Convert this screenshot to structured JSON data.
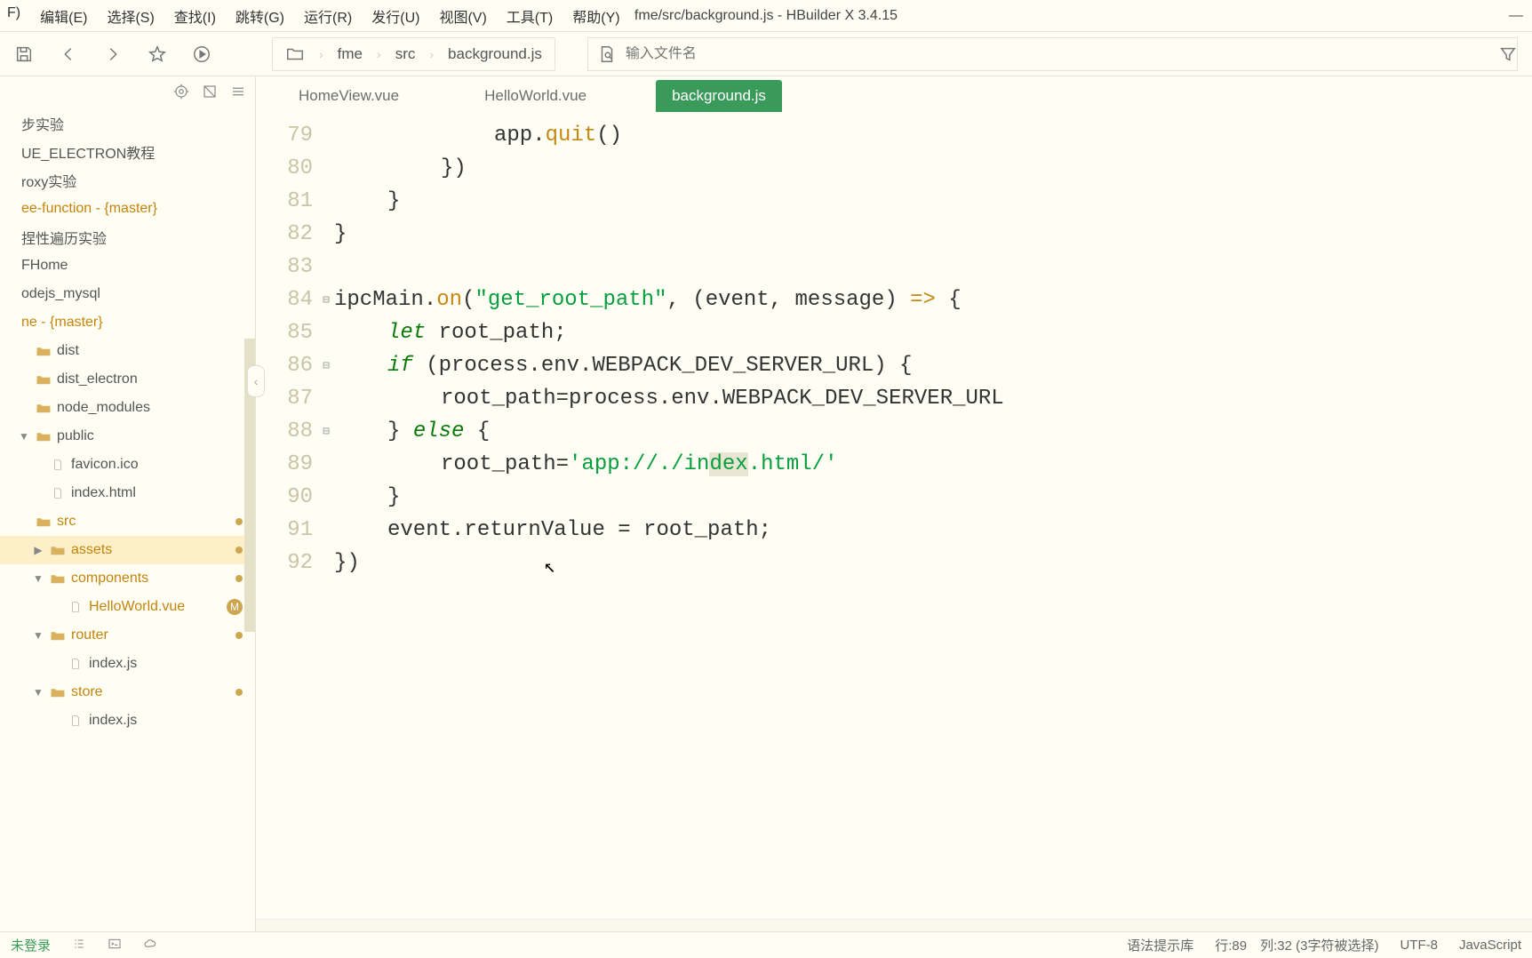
{
  "menus": [
    "F)",
    "编辑(E)",
    "选择(S)",
    "查找(I)",
    "跳转(G)",
    "运行(R)",
    "发行(U)",
    "视图(V)",
    "工具(T)",
    "帮助(Y)"
  ],
  "window_title": "fme/src/background.js - HBuilder X 3.4.15",
  "breadcrumb": [
    "fme",
    "src",
    "background.js"
  ],
  "search_placeholder": "输入文件名",
  "tabs": [
    {
      "label": "HomeView.vue",
      "active": false
    },
    {
      "label": "HelloWorld.vue",
      "active": false
    },
    {
      "label": "background.js",
      "active": true
    }
  ],
  "code": {
    "lines": [
      {
        "n": "79",
        "indent": "i4",
        "tokens": [
          {
            "t": "app."
          },
          {
            "t": "quit",
            "c": "fn"
          },
          {
            "t": "()"
          }
        ]
      },
      {
        "n": "80",
        "indent": "i3",
        "tokens": [
          {
            "t": "})"
          }
        ]
      },
      {
        "n": "81",
        "indent": "i2",
        "tokens": [
          {
            "t": "}"
          }
        ]
      },
      {
        "n": "82",
        "indent": "i1",
        "tokens": [
          {
            "t": "}"
          }
        ]
      },
      {
        "n": "83",
        "indent": "i1",
        "tokens": []
      },
      {
        "n": "84",
        "indent": "i1",
        "fold": "⊟",
        "tokens": [
          {
            "t": "ipcMain."
          },
          {
            "t": "on",
            "c": "fn"
          },
          {
            "t": "("
          },
          {
            "t": "\"get_root_path\"",
            "c": "str"
          },
          {
            "t": ", (event, message) "
          },
          {
            "t": "=>",
            "c": "fn"
          },
          {
            "t": " {"
          }
        ]
      },
      {
        "n": "85",
        "indent": "i2",
        "tokens": [
          {
            "t": "let",
            "c": "kw"
          },
          {
            "t": " root_path;"
          }
        ]
      },
      {
        "n": "86",
        "indent": "i2",
        "fold": "⊟",
        "tokens": [
          {
            "t": "if",
            "c": "kw"
          },
          {
            "t": " (process.env.WEBPACK_DEV_SERVER_URL) {"
          }
        ]
      },
      {
        "n": "87",
        "indent": "i3",
        "tokens": [
          {
            "t": "root_path=process.env.WEBPACK_DEV_SERVER_URL"
          }
        ]
      },
      {
        "n": "88",
        "indent": "i2",
        "fold": "⊟",
        "tokens": [
          {
            "t": "} "
          },
          {
            "t": "else",
            "c": "kw"
          },
          {
            "t": " {"
          }
        ]
      },
      {
        "n": "89",
        "indent": "i3",
        "tokens": [
          {
            "t": "root_path="
          },
          {
            "t": "'app://./in",
            "c": "str"
          },
          {
            "t": "dex",
            "c": "str sel"
          },
          {
            "t": ".html/'",
            "c": "str"
          }
        ]
      },
      {
        "n": "90",
        "indent": "i2",
        "tokens": [
          {
            "t": "}"
          }
        ]
      },
      {
        "n": "91",
        "indent": "i2",
        "tokens": [
          {
            "t": "event.returnValue = root_path;"
          }
        ]
      },
      {
        "n": "92",
        "indent": "i1",
        "tokens": [
          {
            "t": "})"
          }
        ]
      }
    ]
  },
  "tree": [
    {
      "label": "步实验",
      "pad": "pad-0",
      "color": "plain"
    },
    {
      "label": "UE_ELECTRON教程",
      "pad": "pad-0",
      "color": "plain"
    },
    {
      "label": "roxy实验",
      "pad": "pad-0",
      "color": "plain"
    },
    {
      "label": "ee-function - {master}",
      "pad": "pad-0"
    },
    {
      "label": "捏性遍历实验",
      "pad": "pad-0",
      "color": "plain"
    },
    {
      "label": "FHome",
      "pad": "pad-0",
      "color": "plain"
    },
    {
      "label": "odejs_mysql",
      "pad": "pad-0",
      "color": "plain"
    },
    {
      "label": "ne - {master}",
      "pad": "pad-0"
    },
    {
      "label": "dist",
      "pad": "pad-1",
      "icon": "folder",
      "color": "plain"
    },
    {
      "label": "dist_electron",
      "pad": "pad-1",
      "icon": "folder",
      "color": "plain"
    },
    {
      "label": "node_modules",
      "pad": "pad-1",
      "icon": "folder",
      "color": "plain"
    },
    {
      "label": "public",
      "pad": "pad-1",
      "chev": "▼",
      "icon": "folder",
      "color": "plain"
    },
    {
      "label": "favicon.ico",
      "pad": "pad-2",
      "icon": "file",
      "color": "plain"
    },
    {
      "label": "index.html",
      "pad": "pad-2",
      "icon": "file",
      "color": "plain"
    },
    {
      "label": "src",
      "pad": "pad-1",
      "icon": "folder",
      "dot": true
    },
    {
      "label": "assets",
      "pad": "pad-2",
      "chev": "▶",
      "icon": "folder",
      "active": true,
      "dot": true
    },
    {
      "label": "components",
      "pad": "pad-2",
      "chev": "▼",
      "icon": "folder",
      "dot": true
    },
    {
      "label": "HelloWorld.vue",
      "pad": "pad-3",
      "icon": "file",
      "badge": "M"
    },
    {
      "label": "router",
      "pad": "pad-2",
      "chev": "▼",
      "icon": "folder",
      "dot": true
    },
    {
      "label": "index.js",
      "pad": "pad-3",
      "icon": "file",
      "color": "plain"
    },
    {
      "label": "store",
      "pad": "pad-2",
      "chev": "▼",
      "icon": "folder",
      "dot": true
    },
    {
      "label": "index.js",
      "pad": "pad-3",
      "icon": "file",
      "color": "plain"
    }
  ],
  "status": {
    "login": "未登录",
    "syntax": "语法提示库",
    "pos": "行:89　列:32 (3字符被选择)",
    "enc": "UTF-8",
    "lang": "JavaScript"
  }
}
